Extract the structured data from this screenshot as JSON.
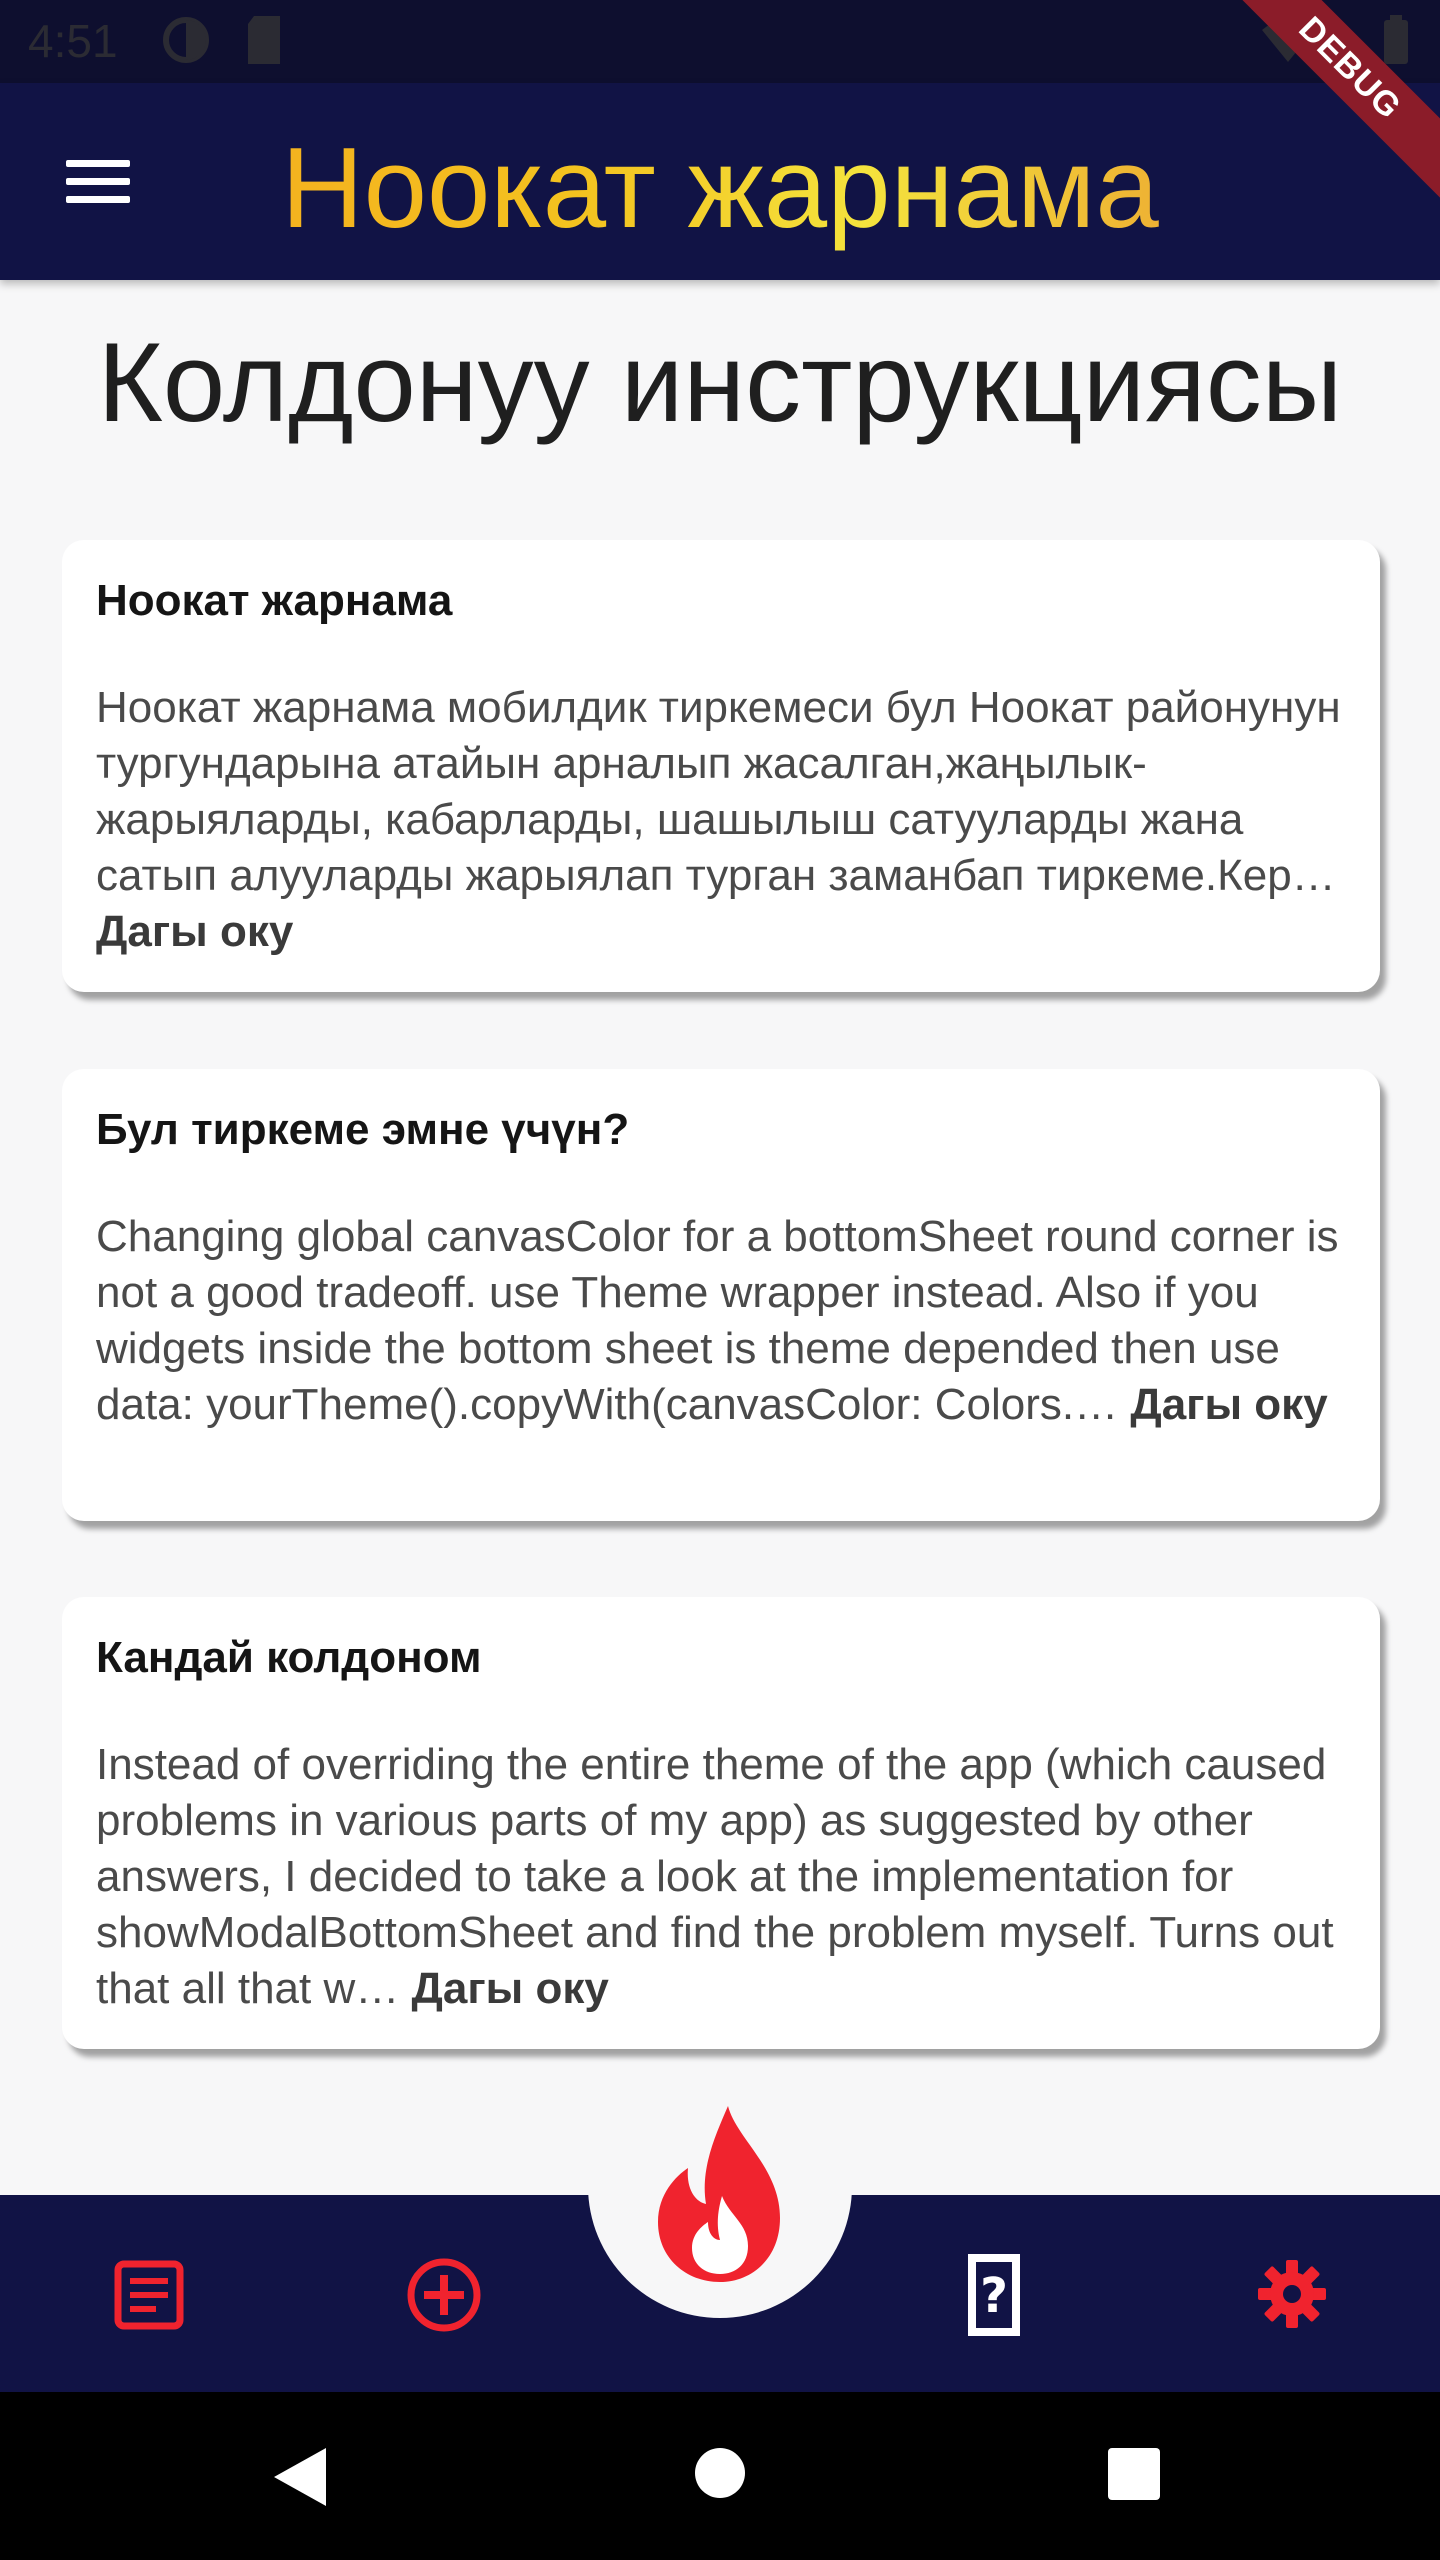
{
  "status_bar": {
    "time": "4:51"
  },
  "app_bar": {
    "title": "Ноокат жарнама",
    "debug_label": "DEBUG"
  },
  "page": {
    "title": "Колдонуу инструкциясы"
  },
  "cards": [
    {
      "title": "Ноокат жарнама",
      "body": "Ноокат жарнама мобилдик тиркемеси бул Ноокат районунун тургундарына атайын арналып жасалган,жаңылык-жарыяларды, кабарларды, шашылыш сатууларды жана сатып алууларды жарыялап турган заманбап тиркеме.Кер…",
      "more": "Дагы оку"
    },
    {
      "title": "Бул тиркеме эмне үчүн?",
      "body": "Changing global canvasColor for a bottomSheet round corner is not a good tradeoff. use Theme wrapper instead. Also if you widgets inside the bottom sheet is theme depended then use data: yourTheme().copyWith(canvasColor: Colors.…",
      "more": "Дагы оку"
    },
    {
      "title": "Кандай колдоном",
      "body": "Instead of overriding the entire theme of the app (which caused problems in various parts of my app) as suggested by other answers, I decided to take a look at the implementation for showModalBottomSheet and find the problem myself. Turns out that all that w…",
      "more": "Дагы оку"
    }
  ],
  "bottom_nav": {
    "items": [
      "list-icon",
      "add-circle-icon",
      "fire-icon",
      "help-icon",
      "settings-icon"
    ],
    "accent_color": "#f0232e",
    "background_color": "#111345"
  },
  "system_nav": {
    "items": [
      "back-icon",
      "home-icon",
      "recents-icon"
    ]
  }
}
